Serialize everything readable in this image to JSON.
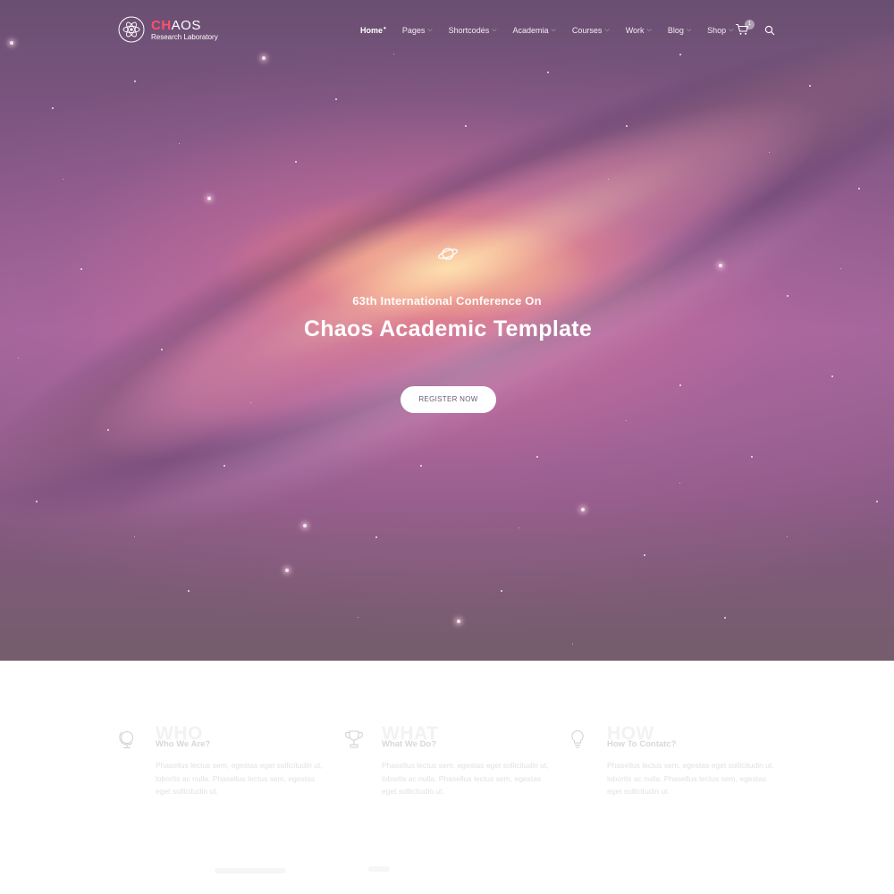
{
  "header": {
    "logo": {
      "accent": "CH",
      "rest": "AOS",
      "subtitle": "Research Laboratory"
    },
    "nav": [
      {
        "label": "Home",
        "active": true
      },
      {
        "label": "Pages"
      },
      {
        "label": "Shortcodes"
      },
      {
        "label": "Academia"
      },
      {
        "label": "Courses"
      },
      {
        "label": "Work"
      },
      {
        "label": "Blog"
      },
      {
        "label": "Shop"
      }
    ],
    "cart_count": "1",
    "cart_icon": "cart-icon",
    "search_icon": "search-icon"
  },
  "hero": {
    "icon": "planet-icon",
    "subtitle": "63th International Conference On",
    "title": "Chaos Academic Template",
    "button": "REGISTER NOW"
  },
  "features": [
    {
      "icon": "globe-icon",
      "bg_word": "WHO",
      "title": "Who We Are?",
      "text": "Phasellus lectus sem, egestas eget sollicitudin ut, lobortis ac nulla. Phasellus lectus sem, egestas eget sollicitudin ut."
    },
    {
      "icon": "trophy-icon",
      "bg_word": "WHAT",
      "title": "What We Do?",
      "text": "Phasellus lectus sem, egestas eget sollicitudin ut, lobortis ac nulla. Phasellus lectus sem, egestas eget sollicitudin ut."
    },
    {
      "icon": "lightbulb-icon",
      "bg_word": "HOW",
      "title": "How To Contatc?",
      "text": "Phasellus lectus sem, egestas eget sollicitudin ut, lobortis ac nulla. Phasellus lectus sem, egestas eget sollicitudin ut."
    }
  ],
  "colors": {
    "accent": "#ff4f6b",
    "hero_base": "#8a5a8a",
    "button_text": "#6b5a78"
  }
}
